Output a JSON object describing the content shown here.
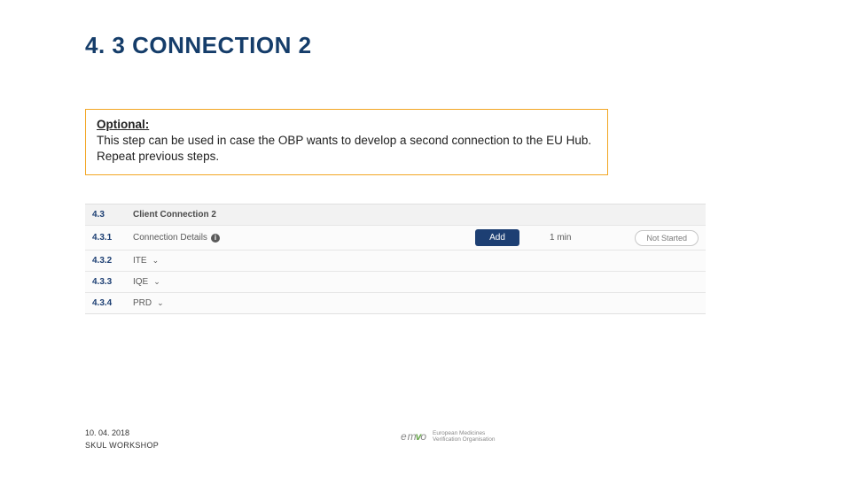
{
  "title": "4. 3 CONNECTION 2",
  "callout": {
    "label": "Optional:",
    "line1": "This step can be used in case the OBP wants to develop a second connection to the EU Hub.",
    "line2": "Repeat previous steps."
  },
  "panel": {
    "header": {
      "num": "4.3",
      "name": "Client Connection 2"
    },
    "detail": {
      "num": "4.3.1",
      "name": "Connection Details",
      "info_glyph": "i",
      "action": "Add",
      "time": "1 min",
      "status": "Not Started"
    },
    "envs": [
      {
        "num": "4.3.2",
        "name": "ITE"
      },
      {
        "num": "4.3.3",
        "name": "IQE"
      },
      {
        "num": "4.3.4",
        "name": "PRD"
      }
    ],
    "chevron_glyph": "⌄"
  },
  "footer": {
    "date": "10. 04. 2018",
    "event": "SKUL WORKSHOP"
  },
  "brand": {
    "mark_left": "em",
    "mark_check": "v",
    "mark_right": "o",
    "line1": "European Medicines",
    "line2": "Verification Organisation"
  }
}
